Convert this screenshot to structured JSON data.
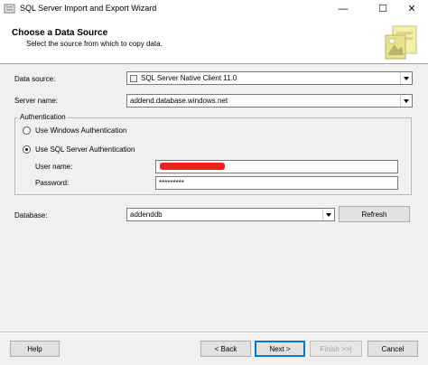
{
  "window": {
    "title": "SQL Server Import and Export Wizard",
    "minimize_glyph": "—",
    "maximize_glyph": "☐",
    "close_glyph": "✕"
  },
  "header": {
    "heading": "Choose a Data Source",
    "subtitle": "Select the source from which to copy data."
  },
  "form": {
    "data_source_label": "Data source:",
    "data_source_value": "SQL Server Native Client 11.0",
    "server_name_label": "Server name:",
    "server_name_value": "addend.database.windows.net",
    "authentication": {
      "legend": "Authentication",
      "windows_auth_label": "Use Windows Authentication",
      "windows_auth_selected": false,
      "sql_auth_label": "Use SQL Server Authentication",
      "sql_auth_selected": true,
      "user_name_label": "User name:",
      "user_name_value": "",
      "password_label": "Password:",
      "password_value": "*********"
    },
    "database_label": "Database:",
    "database_value": "addenddb",
    "refresh_label": "Refresh"
  },
  "footer": {
    "help_label": "Help",
    "back_label": "< Back",
    "next_label": "Next >",
    "finish_label": "Finish >>|",
    "cancel_label": "Cancel"
  },
  "colors": {
    "redaction": "#e8231b",
    "default_button_border": "#0078d7"
  }
}
